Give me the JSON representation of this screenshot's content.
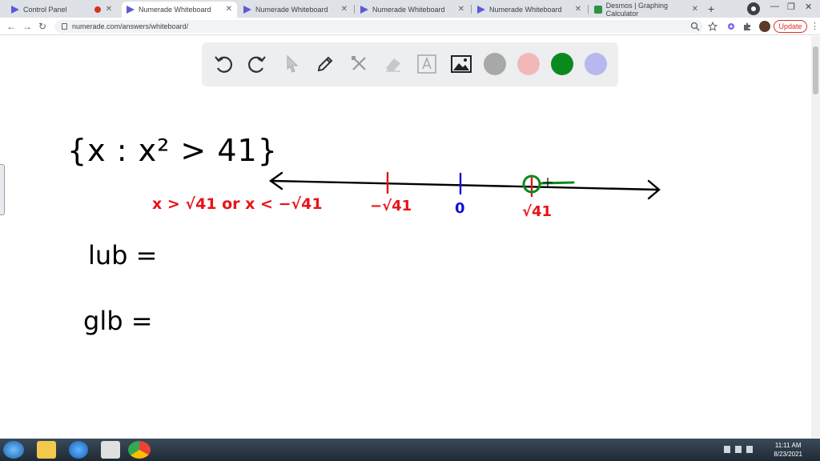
{
  "browser": {
    "tabs": [
      {
        "title": "Control Panel",
        "favicon": "numerade-icon",
        "recording": true
      },
      {
        "title": "Numerade Whiteboard",
        "favicon": "numerade-icon",
        "active": true
      },
      {
        "title": "Numerade Whiteboard",
        "favicon": "numerade-icon"
      },
      {
        "title": "Numerade Whiteboard",
        "favicon": "numerade-icon"
      },
      {
        "title": "Numerade Whiteboard",
        "favicon": "numerade-icon"
      },
      {
        "title": "Desmos | Graphing Calculator",
        "favicon": "desmos-icon"
      }
    ],
    "new_tab": "+",
    "url": "numerade.com/answers/whiteboard/",
    "update_label": "Update"
  },
  "toolbar": {
    "tools": [
      "undo-icon",
      "redo-icon",
      "pointer-icon",
      "pen-icon",
      "tools-icon",
      "eraser-icon",
      "text-icon",
      "image-icon"
    ],
    "colors": [
      "#a8a8a8",
      "#f2b8b8",
      "#0a8a1e",
      "#b8b8f0"
    ]
  },
  "whiteboard": {
    "set": "{x : x² > 41}",
    "condition": "x > √41 or x < −√41",
    "tick_neg": "−√41",
    "tick_zero": "0",
    "tick_pos": "√41",
    "lub_label": "lub =",
    "glb_label": "glb ="
  },
  "taskbar": {
    "time": "11:11 AM",
    "date": "8/23/2021"
  }
}
